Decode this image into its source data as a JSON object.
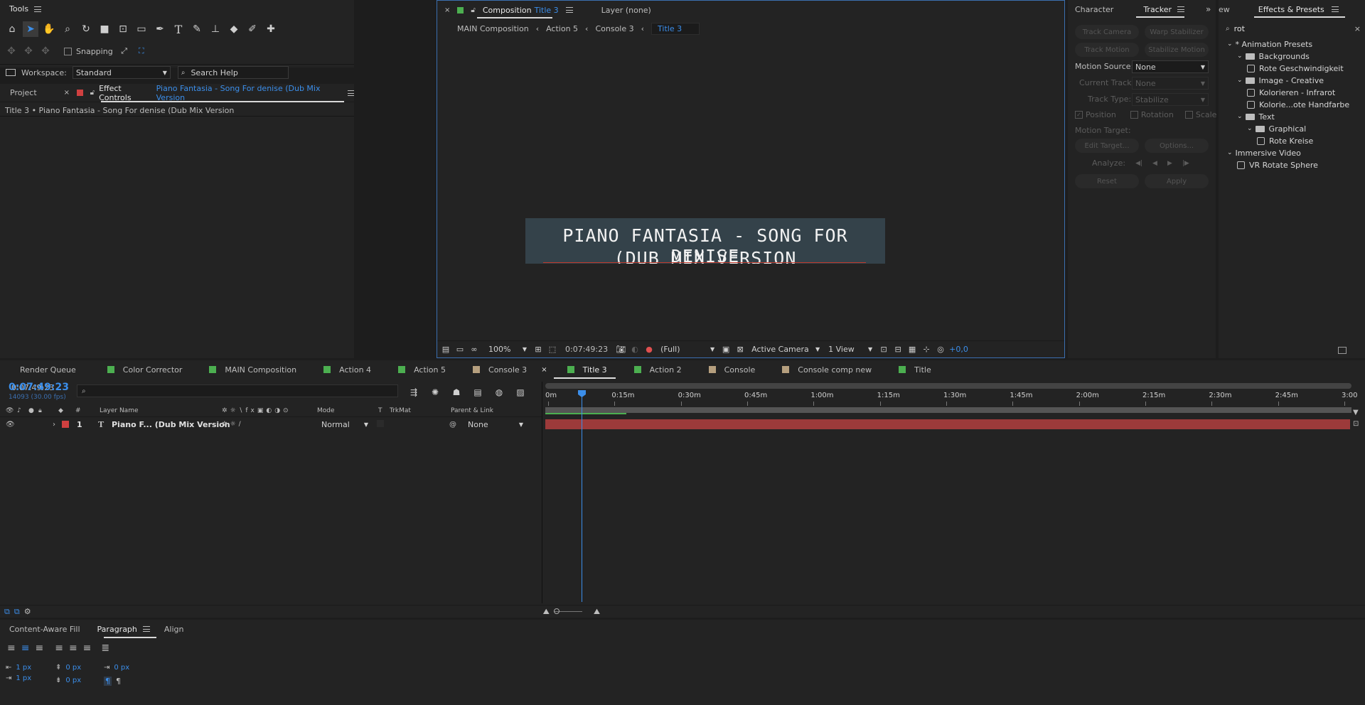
{
  "tools_panel": {
    "title": "Tools",
    "snapping_label": "Snapping",
    "workspace_label": "Workspace:",
    "workspace_value": "Standard",
    "search_help_placeholder": "Search Help"
  },
  "project_panel": {
    "project_tab": "Project",
    "effect_controls_tab": "Effect Controls",
    "effect_controls_layer": "Piano Fantasia - Song For denise (Dub Mix Version",
    "breadcrumb": "Title 3 • Piano Fantasia - Song For denise (Dub Mix Version"
  },
  "composition_panel": {
    "tab_label": "Composition",
    "tab_comp_name": "Title 3",
    "layer_tab": "Layer (none)",
    "flow": [
      "MAIN Composition",
      "Action 5",
      "Console 3",
      "Title 3"
    ],
    "title_card_line1": "PIANO FANTASIA - SONG FOR DENISE",
    "title_card_line2": "(DUB MIX VERSION",
    "footer": {
      "zoom": "100%",
      "timecode": "0:07:49:23",
      "resolution": "(Full)",
      "camera": "Active Camera",
      "views": "1 View",
      "exposure": "+0,0"
    }
  },
  "tracker_panel": {
    "character_tab": "Character",
    "tracker_tab": "Tracker",
    "track_camera": "Track Camera",
    "warp_stabilizer": "Warp Stabilizer",
    "track_motion": "Track Motion",
    "stabilize_motion": "Stabilize Motion",
    "motion_source_label": "Motion Source:",
    "motion_source_value": "None",
    "current_track_label": "Current Track:",
    "current_track_value": "None",
    "track_type_label": "Track Type:",
    "track_type_value": "Stabilize",
    "position": "Position",
    "rotation": "Rotation",
    "scale": "Scale",
    "motion_target_label": "Motion Target:",
    "edit_target": "Edit Target...",
    "options": "Options...",
    "analyze_label": "Analyze:",
    "reset": "Reset",
    "apply": "Apply"
  },
  "effects_panel": {
    "partial_tab": "ew",
    "title": "Effects & Presets",
    "search_value": "rot",
    "tree": [
      {
        "label": "* Animation Presets",
        "level": 0,
        "kind": "root"
      },
      {
        "label": "Backgrounds",
        "level": 1,
        "kind": "folder"
      },
      {
        "label": "Rote Geschwindigkeit",
        "level": 2,
        "kind": "preset"
      },
      {
        "label": "Image - Creative",
        "level": 1,
        "kind": "folder"
      },
      {
        "label": "Kolorieren - Infrarot",
        "level": 2,
        "kind": "preset"
      },
      {
        "label": "Kolorie...ote Handfarbe",
        "level": 2,
        "kind": "preset"
      },
      {
        "label": "Text",
        "level": 1,
        "kind": "folder"
      },
      {
        "label": "Graphical",
        "level": 2,
        "kind": "folder"
      },
      {
        "label": "Rote Kreise",
        "level": 3,
        "kind": "preset"
      },
      {
        "label": "Immersive Video",
        "level": 0,
        "kind": "root"
      },
      {
        "label": "VR Rotate Sphere",
        "level": 1,
        "kind": "effect"
      }
    ]
  },
  "timeline_tabs": [
    {
      "label": "Render Queue",
      "color": ""
    },
    {
      "label": "Color Corrector",
      "color": "#4caf50"
    },
    {
      "label": "MAIN Composition",
      "color": "#4caf50"
    },
    {
      "label": "Action 4",
      "color": "#4caf50"
    },
    {
      "label": "Action 5",
      "color": "#4caf50"
    },
    {
      "label": "Console 3",
      "color": "#b59f7e"
    },
    {
      "label": "Title 3",
      "color": "#4caf50"
    },
    {
      "label": "Action 2",
      "color": "#4caf50"
    },
    {
      "label": "Console",
      "color": "#b59f7e"
    },
    {
      "label": "Console comp new",
      "color": "#b59f7e"
    },
    {
      "label": "Title",
      "color": "#4caf50"
    }
  ],
  "timeline": {
    "timecode": "0:07:49:23",
    "frames": "14093 (30.00 fps)",
    "columns": {
      "layer_name": "Layer Name",
      "mode": "Mode",
      "t": "T",
      "trkmat": "TrkMat",
      "parent_link": "Parent & Link"
    },
    "layer": {
      "index": "1",
      "type": "T",
      "name": "Piano F... (Dub Mix Version",
      "mode": "Normal",
      "parent": "None",
      "label_color": "#d04040"
    },
    "ruler": [
      "0m",
      "0:15m",
      "0:30m",
      "0:45m",
      "1:00m",
      "1:15m",
      "1:30m",
      "1:45m",
      "2:00m",
      "2:15m",
      "2:30m",
      "2:45m",
      "3:00"
    ]
  },
  "paragraph_panel": {
    "content_aware_fill_tab": "Content-Aware Fill",
    "paragraph_tab": "Paragraph",
    "align_tab": "Align",
    "indent_left": "1 px",
    "indent_right": "1 px",
    "space_before": "0 px",
    "space_after": "0 px",
    "first_line": "0 px"
  }
}
